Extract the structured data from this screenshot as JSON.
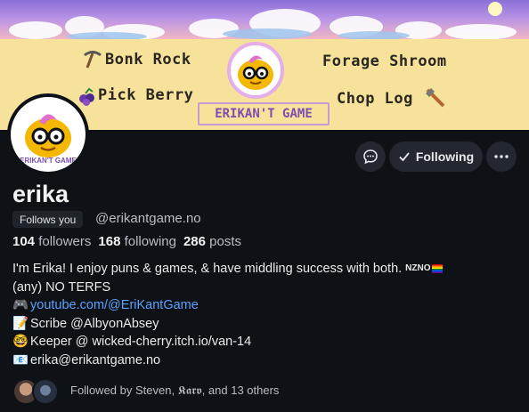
{
  "banner": {
    "actions": {
      "bonk": "Bonk Rock",
      "pick": "Pick Berry",
      "forage": "Forage Shroom",
      "chop": "Chop Log"
    },
    "logo_label": "ERIKAN'T GAME"
  },
  "avatar": {
    "label": "ERIKAN'T GAME"
  },
  "actions": {
    "following_label": "Following"
  },
  "profile": {
    "display_name": "erika",
    "follows_you": "Follows you",
    "handle": "@erikantgame.no",
    "stats": {
      "followers_count": "104",
      "followers_label": "followers",
      "following_count": "168",
      "following_label": "following",
      "posts_count": "286",
      "posts_label": "posts"
    }
  },
  "bio": {
    "line1": "I'm Erika! I enjoy puns & games, & have middling success with both.",
    "pronoun_tag": "NZNO",
    "line2": "(any) NO TERFS",
    "link_emoji": "🎮",
    "link": "youtube.com/@EriKantGame",
    "scribe_emoji": "📝",
    "scribe": "Scribe @AlbyonAbsey",
    "keeper_emoji": "🤓",
    "keeper": "Keeper @ wicked-cherry.itch.io/van-14",
    "email_emoji": "📧",
    "email": "erika@erikantgame.no"
  },
  "followed_by": "Followed by Steven, 𝕶𝖆𝖗𝖛, and 13 others",
  "colors": {
    "background": "#0e1115",
    "banner": "#f6e29a",
    "link": "#5aa2ff",
    "button": "#232830"
  }
}
